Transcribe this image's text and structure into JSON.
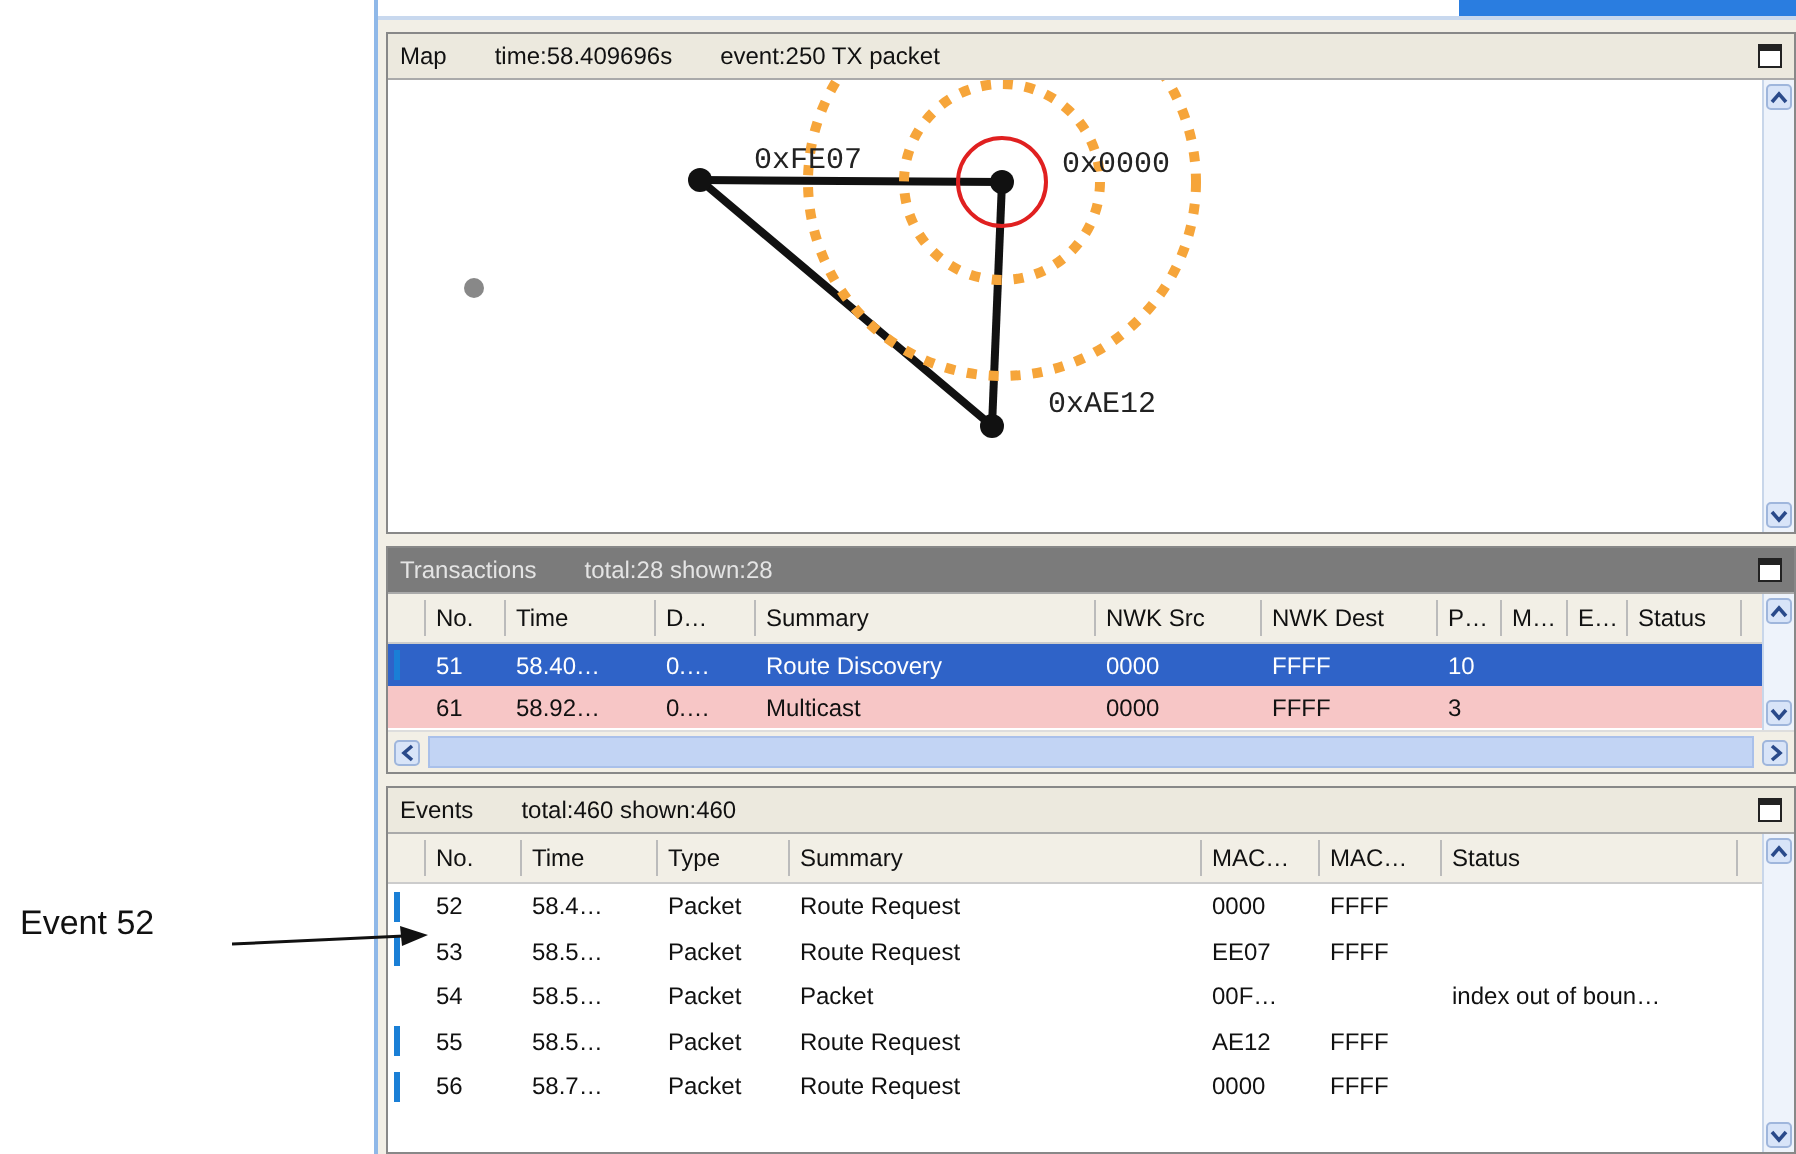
{
  "annotation": {
    "label": "Event 52"
  },
  "map": {
    "title": "Map",
    "time": "time:58.409696s",
    "event": "event:250 TX packet",
    "nodes": [
      {
        "kind": "device",
        "label": "0xFE07",
        "transmitting": false
      },
      {
        "kind": "device",
        "label": "0x0000",
        "transmitting": true
      },
      {
        "kind": "device",
        "label": "0xAE12",
        "transmitting": false
      },
      {
        "kind": "idle"
      }
    ]
  },
  "transactions": {
    "title": "Transactions",
    "counts": "total:28 shown:28",
    "columns": [
      "No.",
      "Time",
      "D…",
      "Summary",
      "NWK Src",
      "NWK Dest",
      "P…",
      "M…",
      "E…",
      "Status"
    ],
    "rows": [
      {
        "selected": true,
        "flagged": true,
        "cells": [
          "51",
          "58.40…",
          "0.…",
          "Route Discovery",
          "0000",
          "FFFF",
          "10",
          "",
          "",
          ""
        ]
      },
      {
        "selected": false,
        "flagged": false,
        "color": "#f7c6c6",
        "cells": [
          "61",
          "58.92…",
          "0.…",
          "Multicast",
          "0000",
          "FFFF",
          "3",
          "",
          "",
          ""
        ]
      }
    ]
  },
  "events": {
    "title": "Events",
    "counts": "total:460 shown:460",
    "columns": [
      "No.",
      "Time",
      "Type",
      "Summary",
      "MAC…",
      "MAC…",
      "Status"
    ],
    "rows": [
      {
        "flagged": true,
        "cells": [
          "52",
          "58.4…",
          "Packet",
          "Route Request",
          "0000",
          "FFFF",
          ""
        ]
      },
      {
        "flagged": true,
        "cells": [
          "53",
          "58.5…",
          "Packet",
          "Route Request",
          "EE07",
          "FFFF",
          ""
        ]
      },
      {
        "flagged": false,
        "cells": [
          "54",
          "58.5…",
          "Packet",
          "Packet",
          "00F…",
          "",
          "index out of boun…"
        ]
      },
      {
        "flagged": true,
        "cells": [
          "55",
          "58.5…",
          "Packet",
          "Route Request",
          "AE12",
          "FFFF",
          ""
        ]
      },
      {
        "flagged": true,
        "cells": [
          "56",
          "58.7…",
          "Packet",
          "Route Request",
          "0000",
          "FFFF",
          ""
        ]
      }
    ]
  }
}
